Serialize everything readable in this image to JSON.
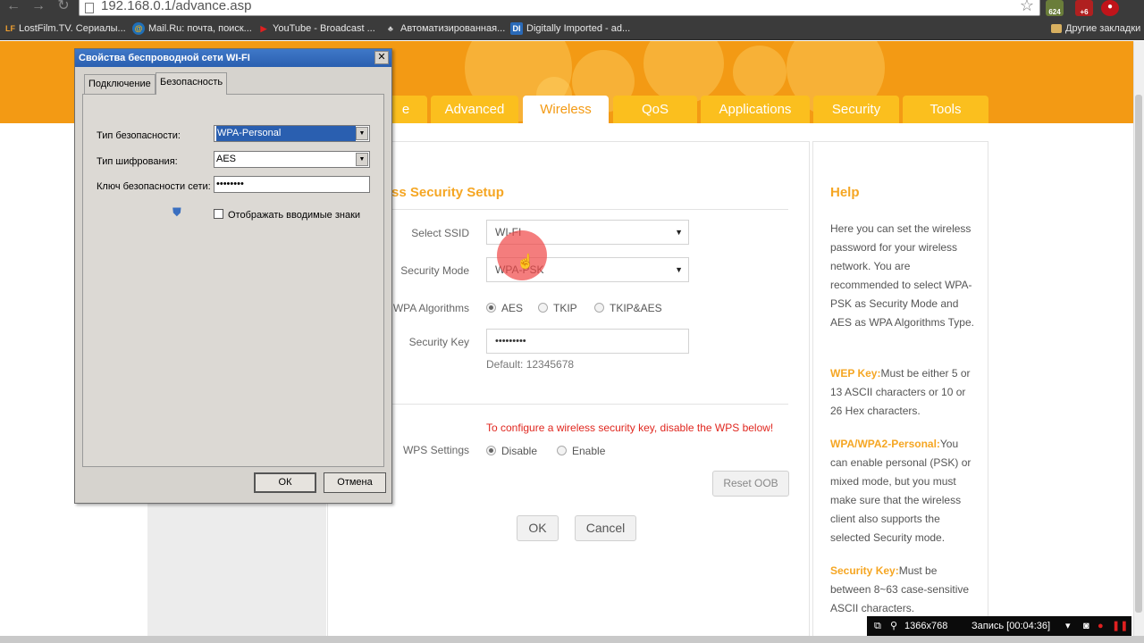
{
  "browser": {
    "url": "192.168.0.1/advance.asp",
    "ext_badges": [
      "624",
      "+6"
    ],
    "bookmarks": [
      {
        "label": "LostFilm.TV. Сериалы...",
        "icon": "LF"
      },
      {
        "label": "Mail.Ru: почта, поиск...",
        "icon": "@"
      },
      {
        "label": "YouTube - Broadcast ...",
        "icon": "▶"
      },
      {
        "label": "Автоматизированная...",
        "icon": "♣"
      },
      {
        "label": "Digitally Imported - ad...",
        "icon": "DI"
      }
    ],
    "other_bookmarks": "Другие закладки"
  },
  "router": {
    "tabs": [
      {
        "label": "e"
      },
      {
        "label": "Advanced"
      },
      {
        "label": "Wireless"
      },
      {
        "label": "QoS"
      },
      {
        "label": "Applications"
      },
      {
        "label": "Security"
      },
      {
        "label": "Tools"
      }
    ],
    "active_tab": "Wireless",
    "section_title": "ss Security Setup",
    "fields": {
      "ssid_label": "Select SSID",
      "ssid_value": "WI-FI",
      "mode_label": "Security Mode",
      "mode_value": "WPA-PSK",
      "alg_label": "WPA Algorithms",
      "alg_options": [
        "AES",
        "TKIP",
        "TKIP&AES"
      ],
      "alg_selected": "AES",
      "key_label": "Security Key",
      "key_value": "•••••••••",
      "key_default": "Default:  12345678"
    },
    "wps": {
      "warning": "To configure a wireless security key, disable the WPS below!",
      "label": "WPS Settings",
      "options": [
        "Disable",
        "Enable"
      ],
      "selected": "Disable",
      "reset_button": "Reset OOB"
    },
    "ok_button": "OK",
    "cancel_button": "Cancel",
    "help": {
      "title": "Help",
      "intro": "Here you can set the wireless password for your wireless network. You are recommended to select WPA-PSK as Security Mode and AES as WPA Algorithms Type.",
      "wep_title": "WEP Key:",
      "wep_text": "Must be either 5 or 13 ASCII characters or 10 or 26 Hex characters.",
      "wpa_title": "WPA/WPA2-Personal:",
      "wpa_text": "You can enable personal (PSK) or mixed mode, but you must make sure that the wireless client also supports the selected Security mode.",
      "key_title": "Security Key:",
      "key_text": "Must be between 8~63 case-sensitive ASCII characters."
    }
  },
  "dialog": {
    "title": "Свойства беспроводной сети WI-FI",
    "close": "✕",
    "tabs": [
      "Подключение",
      "Безопасность"
    ],
    "active_tab": "Безопасность",
    "sec_type_label": "Тип безопасности:",
    "sec_type_value": "WPA-Personal",
    "enc_type_label": "Тип шифрования:",
    "enc_type_value": "AES",
    "key_label": "Ключ безопасности сети:",
    "key_value": "••••••••",
    "show_chars_label": "Отображать вводимые знаки",
    "show_chars_checked": false,
    "ok_button": "ОК",
    "cancel_button": "Отмена"
  },
  "recorder": {
    "resolution": "1366x768",
    "status": "Запись [00:04:36]"
  },
  "colors": {
    "header_orange": "#f39a14",
    "tab_yellow": "#fbbf1e",
    "accent_text": "#f5a623",
    "warning_red": "#e0271f",
    "dialog_titlebar": "#2a5fb0"
  }
}
